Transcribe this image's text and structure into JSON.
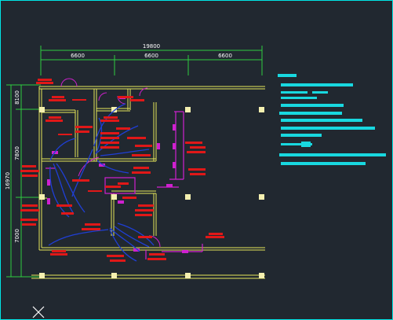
{
  "drawing": {
    "colors": {
      "background": "#212830",
      "frame": "#00e5e5",
      "wall": "#e8e85a",
      "dimension": "#2ecc40",
      "circuit": "#1f3fd6",
      "equipment": "#d020d0",
      "annotation": "#e01818",
      "legend": "#18d8e0",
      "column": "#f4f0b0"
    },
    "dimensions": {
      "overall_width": "19800",
      "bay_1": "6600",
      "bay_2": "6600",
      "bay_3": "6600",
      "overall_depth": "16970",
      "row_1": "8100",
      "row_2": "7800",
      "row_3": "7000"
    },
    "icons": {
      "ucs": "ucs-cross-icon"
    }
  }
}
